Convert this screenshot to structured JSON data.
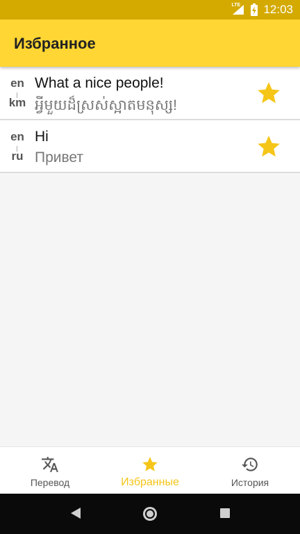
{
  "status": {
    "time": "12:03",
    "network": "LTE"
  },
  "app_bar": {
    "title": "Избранное"
  },
  "favorites": [
    {
      "from": "en",
      "to": "km",
      "source": "What a nice people!",
      "translation": "អ្វីមួយដ៏ស្រស់ស្អាតមនុស្ស!",
      "starred": true
    },
    {
      "from": "en",
      "to": "ru",
      "source": "Hi",
      "translation": "Привет",
      "starred": true
    }
  ],
  "bottom_nav": {
    "translate_label": "Перевод",
    "favorites_label": "Избранные",
    "history_label": "История",
    "active": "favorites"
  },
  "colors": {
    "accent": "#ffd633",
    "star": "#f5c518",
    "status_bar": "#d4aa00"
  }
}
